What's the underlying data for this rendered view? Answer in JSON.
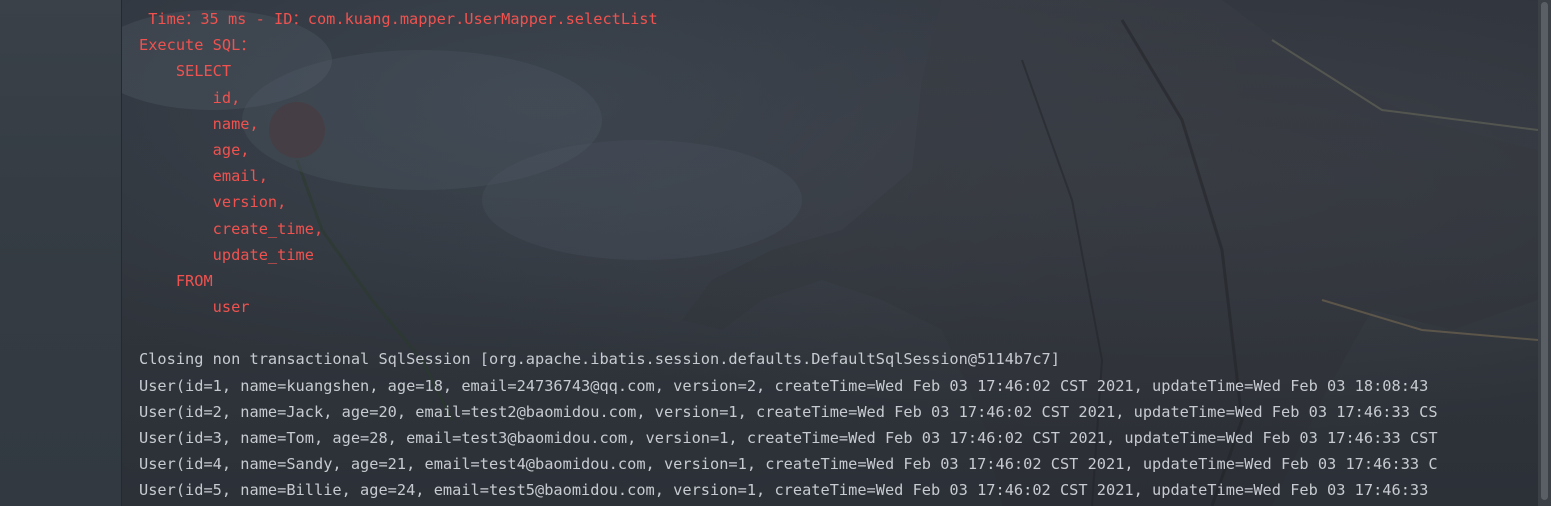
{
  "console": {
    "colors": {
      "sql_log": "#f0524f",
      "stdout": "#c7cbd1",
      "background": "#2f343c"
    },
    "lines": [
      {
        "text": " Time：35 ms - ID：com.kuang.mapper.UserMapper.selectList",
        "style": "red"
      },
      {
        "text": "Execute SQL：",
        "style": "red"
      },
      {
        "text": "    SELECT",
        "style": "red"
      },
      {
        "text": "        id,",
        "style": "red"
      },
      {
        "text": "        name,",
        "style": "red"
      },
      {
        "text": "        age,",
        "style": "red"
      },
      {
        "text": "        email,",
        "style": "red"
      },
      {
        "text": "        version,",
        "style": "red"
      },
      {
        "text": "        create_time,",
        "style": "red"
      },
      {
        "text": "        update_time",
        "style": "red"
      },
      {
        "text": "    FROM",
        "style": "red"
      },
      {
        "text": "        user",
        "style": "red"
      },
      {
        "text": "",
        "style": "plain"
      },
      {
        "text": "Closing non transactional SqlSession [org.apache.ibatis.session.defaults.DefaultSqlSession@5114b7c7]",
        "style": "plain"
      },
      {
        "text": "User(id=1, name=kuangshen, age=18, email=24736743@qq.com, version=2, createTime=Wed Feb 03 17:46:02 CST 2021, updateTime=Wed Feb 03 18:08:43",
        "style": "plain"
      },
      {
        "text": "User(id=2, name=Jack, age=20, email=test2@baomidou.com, version=1, createTime=Wed Feb 03 17:46:02 CST 2021, updateTime=Wed Feb 03 17:46:33 CS",
        "style": "plain"
      },
      {
        "text": "User(id=3, name=Tom, age=28, email=test3@baomidou.com, version=1, createTime=Wed Feb 03 17:46:02 CST 2021, updateTime=Wed Feb 03 17:46:33 CST",
        "style": "plain"
      },
      {
        "text": "User(id=4, name=Sandy, age=21, email=test4@baomidou.com, version=1, createTime=Wed Feb 03 17:46:02 CST 2021, updateTime=Wed Feb 03 17:46:33 C",
        "style": "plain"
      },
      {
        "text": "User(id=5, name=Billie, age=24, email=test5@baomidou.com, version=1, createTime=Wed Feb 03 17:46:02 CST 2021, updateTime=Wed Feb 03 17:46:33",
        "style": "plain"
      }
    ]
  }
}
